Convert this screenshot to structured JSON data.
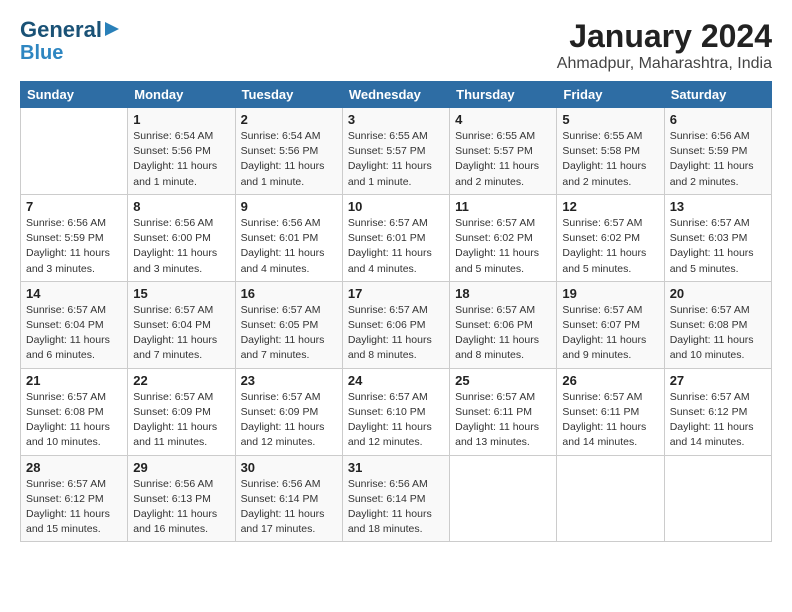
{
  "header": {
    "logo_line1": "General",
    "logo_line2": "Blue",
    "month_title": "January 2024",
    "location": "Ahmadpur, Maharashtra, India"
  },
  "days_of_week": [
    "Sunday",
    "Monday",
    "Tuesday",
    "Wednesday",
    "Thursday",
    "Friday",
    "Saturday"
  ],
  "weeks": [
    [
      {
        "num": "",
        "info": ""
      },
      {
        "num": "1",
        "info": "Sunrise: 6:54 AM\nSunset: 5:56 PM\nDaylight: 11 hours\nand 1 minute."
      },
      {
        "num": "2",
        "info": "Sunrise: 6:54 AM\nSunset: 5:56 PM\nDaylight: 11 hours\nand 1 minute."
      },
      {
        "num": "3",
        "info": "Sunrise: 6:55 AM\nSunset: 5:57 PM\nDaylight: 11 hours\nand 1 minute."
      },
      {
        "num": "4",
        "info": "Sunrise: 6:55 AM\nSunset: 5:57 PM\nDaylight: 11 hours\nand 2 minutes."
      },
      {
        "num": "5",
        "info": "Sunrise: 6:55 AM\nSunset: 5:58 PM\nDaylight: 11 hours\nand 2 minutes."
      },
      {
        "num": "6",
        "info": "Sunrise: 6:56 AM\nSunset: 5:59 PM\nDaylight: 11 hours\nand 2 minutes."
      }
    ],
    [
      {
        "num": "7",
        "info": "Sunrise: 6:56 AM\nSunset: 5:59 PM\nDaylight: 11 hours\nand 3 minutes."
      },
      {
        "num": "8",
        "info": "Sunrise: 6:56 AM\nSunset: 6:00 PM\nDaylight: 11 hours\nand 3 minutes."
      },
      {
        "num": "9",
        "info": "Sunrise: 6:56 AM\nSunset: 6:01 PM\nDaylight: 11 hours\nand 4 minutes."
      },
      {
        "num": "10",
        "info": "Sunrise: 6:57 AM\nSunset: 6:01 PM\nDaylight: 11 hours\nand 4 minutes."
      },
      {
        "num": "11",
        "info": "Sunrise: 6:57 AM\nSunset: 6:02 PM\nDaylight: 11 hours\nand 5 minutes."
      },
      {
        "num": "12",
        "info": "Sunrise: 6:57 AM\nSunset: 6:02 PM\nDaylight: 11 hours\nand 5 minutes."
      },
      {
        "num": "13",
        "info": "Sunrise: 6:57 AM\nSunset: 6:03 PM\nDaylight: 11 hours\nand 5 minutes."
      }
    ],
    [
      {
        "num": "14",
        "info": "Sunrise: 6:57 AM\nSunset: 6:04 PM\nDaylight: 11 hours\nand 6 minutes."
      },
      {
        "num": "15",
        "info": "Sunrise: 6:57 AM\nSunset: 6:04 PM\nDaylight: 11 hours\nand 7 minutes."
      },
      {
        "num": "16",
        "info": "Sunrise: 6:57 AM\nSunset: 6:05 PM\nDaylight: 11 hours\nand 7 minutes."
      },
      {
        "num": "17",
        "info": "Sunrise: 6:57 AM\nSunset: 6:06 PM\nDaylight: 11 hours\nand 8 minutes."
      },
      {
        "num": "18",
        "info": "Sunrise: 6:57 AM\nSunset: 6:06 PM\nDaylight: 11 hours\nand 8 minutes."
      },
      {
        "num": "19",
        "info": "Sunrise: 6:57 AM\nSunset: 6:07 PM\nDaylight: 11 hours\nand 9 minutes."
      },
      {
        "num": "20",
        "info": "Sunrise: 6:57 AM\nSunset: 6:08 PM\nDaylight: 11 hours\nand 10 minutes."
      }
    ],
    [
      {
        "num": "21",
        "info": "Sunrise: 6:57 AM\nSunset: 6:08 PM\nDaylight: 11 hours\nand 10 minutes."
      },
      {
        "num": "22",
        "info": "Sunrise: 6:57 AM\nSunset: 6:09 PM\nDaylight: 11 hours\nand 11 minutes."
      },
      {
        "num": "23",
        "info": "Sunrise: 6:57 AM\nSunset: 6:09 PM\nDaylight: 11 hours\nand 12 minutes."
      },
      {
        "num": "24",
        "info": "Sunrise: 6:57 AM\nSunset: 6:10 PM\nDaylight: 11 hours\nand 12 minutes."
      },
      {
        "num": "25",
        "info": "Sunrise: 6:57 AM\nSunset: 6:11 PM\nDaylight: 11 hours\nand 13 minutes."
      },
      {
        "num": "26",
        "info": "Sunrise: 6:57 AM\nSunset: 6:11 PM\nDaylight: 11 hours\nand 14 minutes."
      },
      {
        "num": "27",
        "info": "Sunrise: 6:57 AM\nSunset: 6:12 PM\nDaylight: 11 hours\nand 14 minutes."
      }
    ],
    [
      {
        "num": "28",
        "info": "Sunrise: 6:57 AM\nSunset: 6:12 PM\nDaylight: 11 hours\nand 15 minutes."
      },
      {
        "num": "29",
        "info": "Sunrise: 6:56 AM\nSunset: 6:13 PM\nDaylight: 11 hours\nand 16 minutes."
      },
      {
        "num": "30",
        "info": "Sunrise: 6:56 AM\nSunset: 6:14 PM\nDaylight: 11 hours\nand 17 minutes."
      },
      {
        "num": "31",
        "info": "Sunrise: 6:56 AM\nSunset: 6:14 PM\nDaylight: 11 hours\nand 18 minutes."
      },
      {
        "num": "",
        "info": ""
      },
      {
        "num": "",
        "info": ""
      },
      {
        "num": "",
        "info": ""
      }
    ]
  ]
}
